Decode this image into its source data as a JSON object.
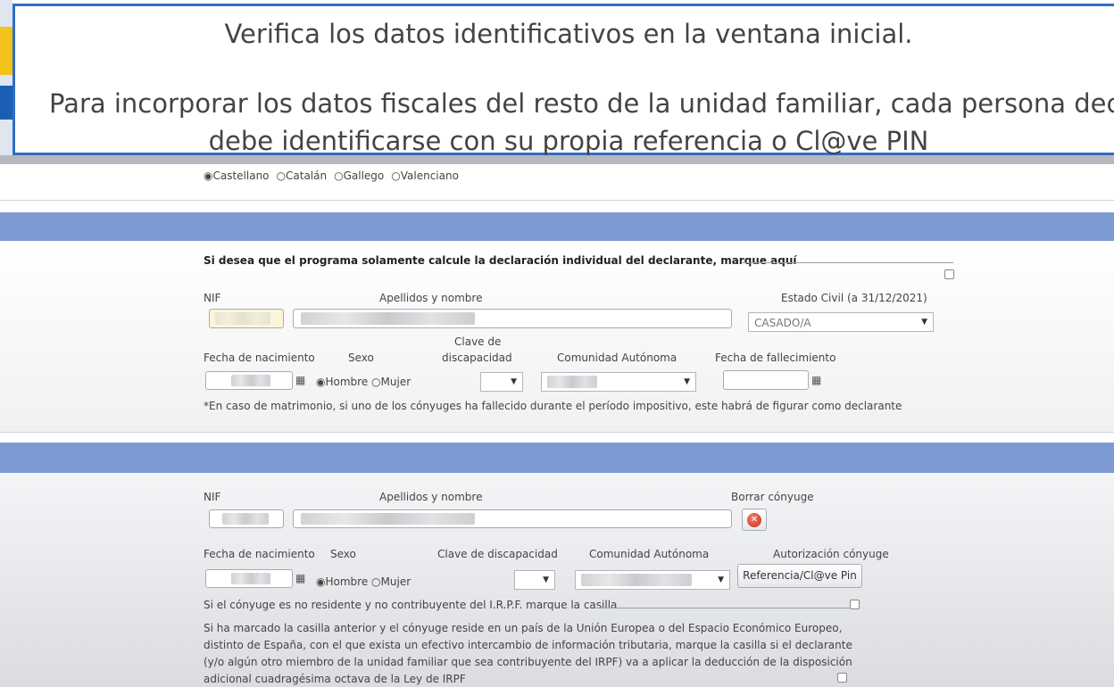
{
  "banner": {
    "line1": "Verifica los datos identificativos en la ventana inicial.",
    "line2": "Para incorporar los datos fiscales del resto de la unidad familiar, cada persona decla",
    "line3": "debe identificarse con su propia referencia o Cl@ve PIN"
  },
  "languages": {
    "castellano": "Castellano",
    "catalan": "Catalán",
    "gallego": "Gallego",
    "valenciano": "Valenciano",
    "selected": "Castellano"
  },
  "declarante": {
    "individual_label": "Si desea que el programa solamente calcule la declaración individual del declarante, marque aquí",
    "nif_label": "NIF",
    "nombre_label": "Apellidos y nombre",
    "estado_civil_label": "Estado Civil (a 31/12/2021)",
    "estado_civil_value": "CASADO/A",
    "fecha_nac_label": "Fecha de nacimiento",
    "sexo_label": "Sexo",
    "discapacidad_label_1": "Clave de",
    "discapacidad_label_2": "discapacidad",
    "comunidad_label": "Comunidad Autónoma",
    "fallecimiento_label": "Fecha de fallecimiento",
    "hombre": "Hombre",
    "mujer": "Mujer",
    "sexo_selected": "Hombre",
    "nota": "*En caso de matrimonio, si uno de los cónyuges ha fallecido durante el período impositivo, este habrá de figurar como declarante"
  },
  "conyuge": {
    "nif_label": "NIF",
    "nombre_label": "Apellidos y nombre",
    "borrar_label": "Borrar cónyuge",
    "fecha_nac_label": "Fecha de nacimiento",
    "sexo_label": "Sexo",
    "discapacidad_label": "Clave de discapacidad",
    "comunidad_label": "Comunidad Autónoma",
    "autorizacion_label": "Autorización cónyuge",
    "referencia_button": "Referencia/Cl@ve Pin",
    "hombre": "Hombre",
    "mujer": "Mujer",
    "sexo_selected": "Hombre",
    "no_residente_label": "Si el cónyuge es no residente y no contribuyente del I.R.P.F. marque la casilla",
    "ue_text_1": "Si ha marcado la casilla anterior y el cónyuge reside en un país de la Unión Europea o del Espacio Económico Europeo,",
    "ue_text_2": "distinto de España, con el que exista un efectivo intercambio de información tributaria, marque la casilla si el declarante",
    "ue_text_3": "(y/o algún otro miembro de la unidad familiar que sea contribuyente del IRPF) va a aplicar la deducción de la disposición",
    "ue_text_4": "adicional cuadragésima octava de la Ley de IRPF"
  },
  "colors": {
    "banner_border": "#2f6ec6",
    "section_band": "#7e9ad4",
    "edge_yellow": "#f3c21b",
    "edge_blue": "#1b5fb4"
  },
  "icons": {
    "calendar": "calendar-icon",
    "delete": "delete-circle-icon",
    "dropdown": "chevron-down-icon"
  }
}
